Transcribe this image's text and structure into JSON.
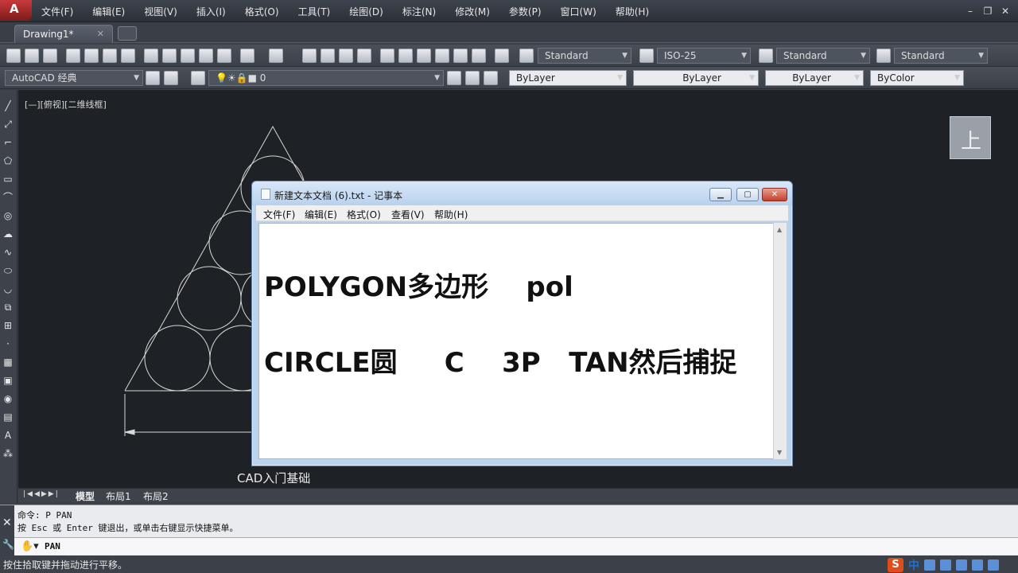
{
  "app": {
    "menu": [
      "文件(F)",
      "编辑(E)",
      "视图(V)",
      "插入(I)",
      "格式(O)",
      "工具(T)",
      "绘图(D)",
      "标注(N)",
      "修改(M)",
      "参数(P)",
      "窗口(W)",
      "帮助(H)"
    ],
    "doc_tab": "Drawing1*",
    "tab_close": "✕"
  },
  "toolbar": {
    "text_style": "Standard",
    "dim_style": "ISO-25",
    "table_style": "Standard",
    "multileader_style": "Standard",
    "workspace": "AutoCAD 经典",
    "layer": "0",
    "color": "ByLayer",
    "linetype": "ByLayer",
    "lineweight": "ByLayer",
    "plotstyle": "ByColor"
  },
  "canvas": {
    "view_label": "[—][俯视][二维线框]",
    "viewcube_label": "上",
    "watermark": "CAD入门基础"
  },
  "layout_tabs": [
    "模型",
    "布局1",
    "布局2"
  ],
  "command": {
    "line1": "命令: P PAN",
    "line2": "按 Esc 或 Enter 键退出，或单击右键显示快捷菜单。",
    "current": "PAN"
  },
  "status": {
    "text": "按住拾取键并拖动进行平移。",
    "ime_s": "S",
    "ime_lang": "中"
  },
  "notepad": {
    "title": "新建文本文档 (6).txt - 记事本",
    "menu": [
      "文件(F)",
      "编辑(E)",
      "格式(O)",
      "查看(V)",
      "帮助(H)"
    ],
    "line1": "POLYGON多边形    pol",
    "line2": "CIRCLE圆     C    3P   TAN然后捕捉"
  },
  "colors": {
    "canvas_bg": "#1e2126",
    "drawing_lines": "#d9d9d9",
    "notepad_title": "#bcd3ee"
  }
}
